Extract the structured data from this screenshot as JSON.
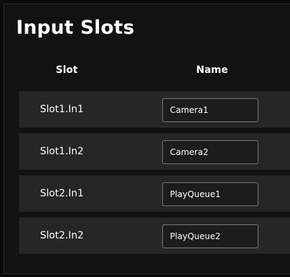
{
  "title": "Input Slots",
  "columns": {
    "slot": "Slot",
    "name": "Name"
  },
  "rows": [
    {
      "slot": "Slot1.In1",
      "name": "Camera1"
    },
    {
      "slot": "Slot1.In2",
      "name": "Camera2"
    },
    {
      "slot": "Slot2.In1",
      "name": "PlayQueue1"
    },
    {
      "slot": "Slot2.In2",
      "name": "PlayQueue2"
    }
  ]
}
